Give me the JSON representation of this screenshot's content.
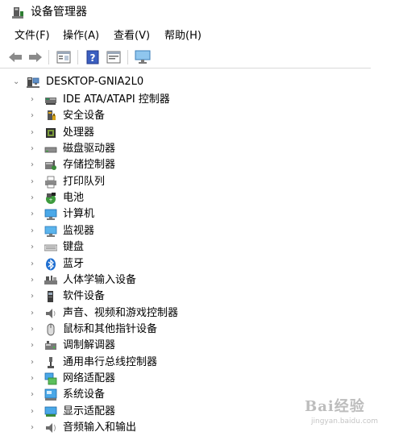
{
  "window": {
    "title": "设备管理器",
    "icon": "device-manager-icon"
  },
  "menu": [
    {
      "label": "文件(F)"
    },
    {
      "label": "操作(A)"
    },
    {
      "label": "查看(V)"
    },
    {
      "label": "帮助(H)"
    }
  ],
  "toolbar": [
    {
      "name": "back-button",
      "icon": "arrow-left-icon"
    },
    {
      "name": "forward-button",
      "icon": "arrow-right-icon"
    },
    {
      "name": "properties-button",
      "icon": "properties-icon"
    },
    {
      "name": "help-button",
      "icon": "help-icon"
    },
    {
      "name": "update-driver-button",
      "icon": "update-driver-icon"
    },
    {
      "name": "scan-hardware-button",
      "icon": "monitor-scan-icon"
    }
  ],
  "tree": {
    "root": {
      "label": "DESKTOP-GNIA2L0",
      "icon": "computer-icon",
      "expanded": true
    },
    "children": [
      {
        "label": "IDE ATA/ATAPI 控制器",
        "icon": "ide-controller-icon"
      },
      {
        "label": "安全设备",
        "icon": "security-device-icon"
      },
      {
        "label": "处理器",
        "icon": "processor-icon"
      },
      {
        "label": "磁盘驱动器",
        "icon": "disk-drive-icon"
      },
      {
        "label": "存储控制器",
        "icon": "storage-controller-icon"
      },
      {
        "label": "打印队列",
        "icon": "printer-icon"
      },
      {
        "label": "电池",
        "icon": "battery-icon"
      },
      {
        "label": "计算机",
        "icon": "computer-monitor-icon"
      },
      {
        "label": "监视器",
        "icon": "monitor-icon"
      },
      {
        "label": "键盘",
        "icon": "keyboard-icon"
      },
      {
        "label": "蓝牙",
        "icon": "bluetooth-icon"
      },
      {
        "label": "人体学输入设备",
        "icon": "hid-icon"
      },
      {
        "label": "软件设备",
        "icon": "software-device-icon"
      },
      {
        "label": "声音、视频和游戏控制器",
        "icon": "sound-icon"
      },
      {
        "label": "鼠标和其他指针设备",
        "icon": "mouse-icon"
      },
      {
        "label": "调制解调器",
        "icon": "modem-icon"
      },
      {
        "label": "通用串行总线控制器",
        "icon": "usb-icon"
      },
      {
        "label": "网络适配器",
        "icon": "network-adapter-icon"
      },
      {
        "label": "系统设备",
        "icon": "system-device-icon"
      },
      {
        "label": "显示适配器",
        "icon": "display-adapter-icon"
      },
      {
        "label": "音频输入和输出",
        "icon": "audio-io-icon"
      }
    ]
  },
  "watermark": {
    "text": "Bai经验",
    "sub": "jingyan.baidu.com"
  }
}
